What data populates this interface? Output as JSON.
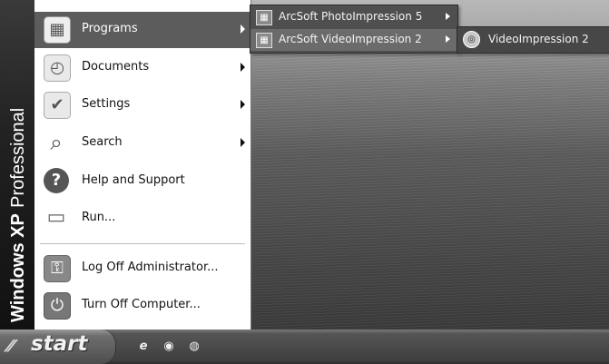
{
  "desktop": {
    "alt": "landscape wallpaper"
  },
  "start_menu": {
    "sidebar_brand_bold": "Windows XP",
    "sidebar_brand_edition": "Professional",
    "items": [
      {
        "label": "Programs",
        "icon": "programs-folder-icon",
        "glyph": "▦",
        "has_submenu": true,
        "active": true
      },
      {
        "label": "Documents",
        "icon": "documents-icon",
        "glyph": "◴",
        "has_submenu": true
      },
      {
        "label": "Settings",
        "icon": "settings-icon",
        "glyph": "✔",
        "has_submenu": true
      },
      {
        "label": "Search",
        "icon": "search-icon",
        "glyph": "⌕",
        "has_submenu": true
      },
      {
        "label": "Help and Support",
        "icon": "help-icon",
        "glyph": "?",
        "has_submenu": false
      },
      {
        "label": "Run...",
        "icon": "run-icon",
        "glyph": "▭",
        "has_submenu": false
      },
      {
        "label": "Log Off Administrator...",
        "icon": "logoff-key-icon",
        "glyph": "⚿",
        "has_submenu": false
      },
      {
        "label": "Turn Off Computer...",
        "icon": "power-icon",
        "glyph": "⏻",
        "has_submenu": false
      }
    ]
  },
  "programs_submenu": {
    "items": [
      {
        "label": "ArcSoft PhotoImpression 5",
        "icon": "program-group-icon",
        "has_submenu": true
      },
      {
        "label": "ArcSoft VideoImpression 2",
        "icon": "program-group-icon",
        "has_submenu": true,
        "active": true
      }
    ]
  },
  "videoimpression_submenu": {
    "items": [
      {
        "label": "VideoImpression 2",
        "icon": "videoimpression-app-icon"
      }
    ]
  },
  "taskbar": {
    "start_label": "start",
    "quick_launch": [
      {
        "icon": "internet-explorer-icon",
        "glyph": "e"
      },
      {
        "icon": "media-player-icon",
        "glyph": "◉"
      },
      {
        "icon": "show-desktop-icon",
        "glyph": "◍"
      }
    ]
  }
}
